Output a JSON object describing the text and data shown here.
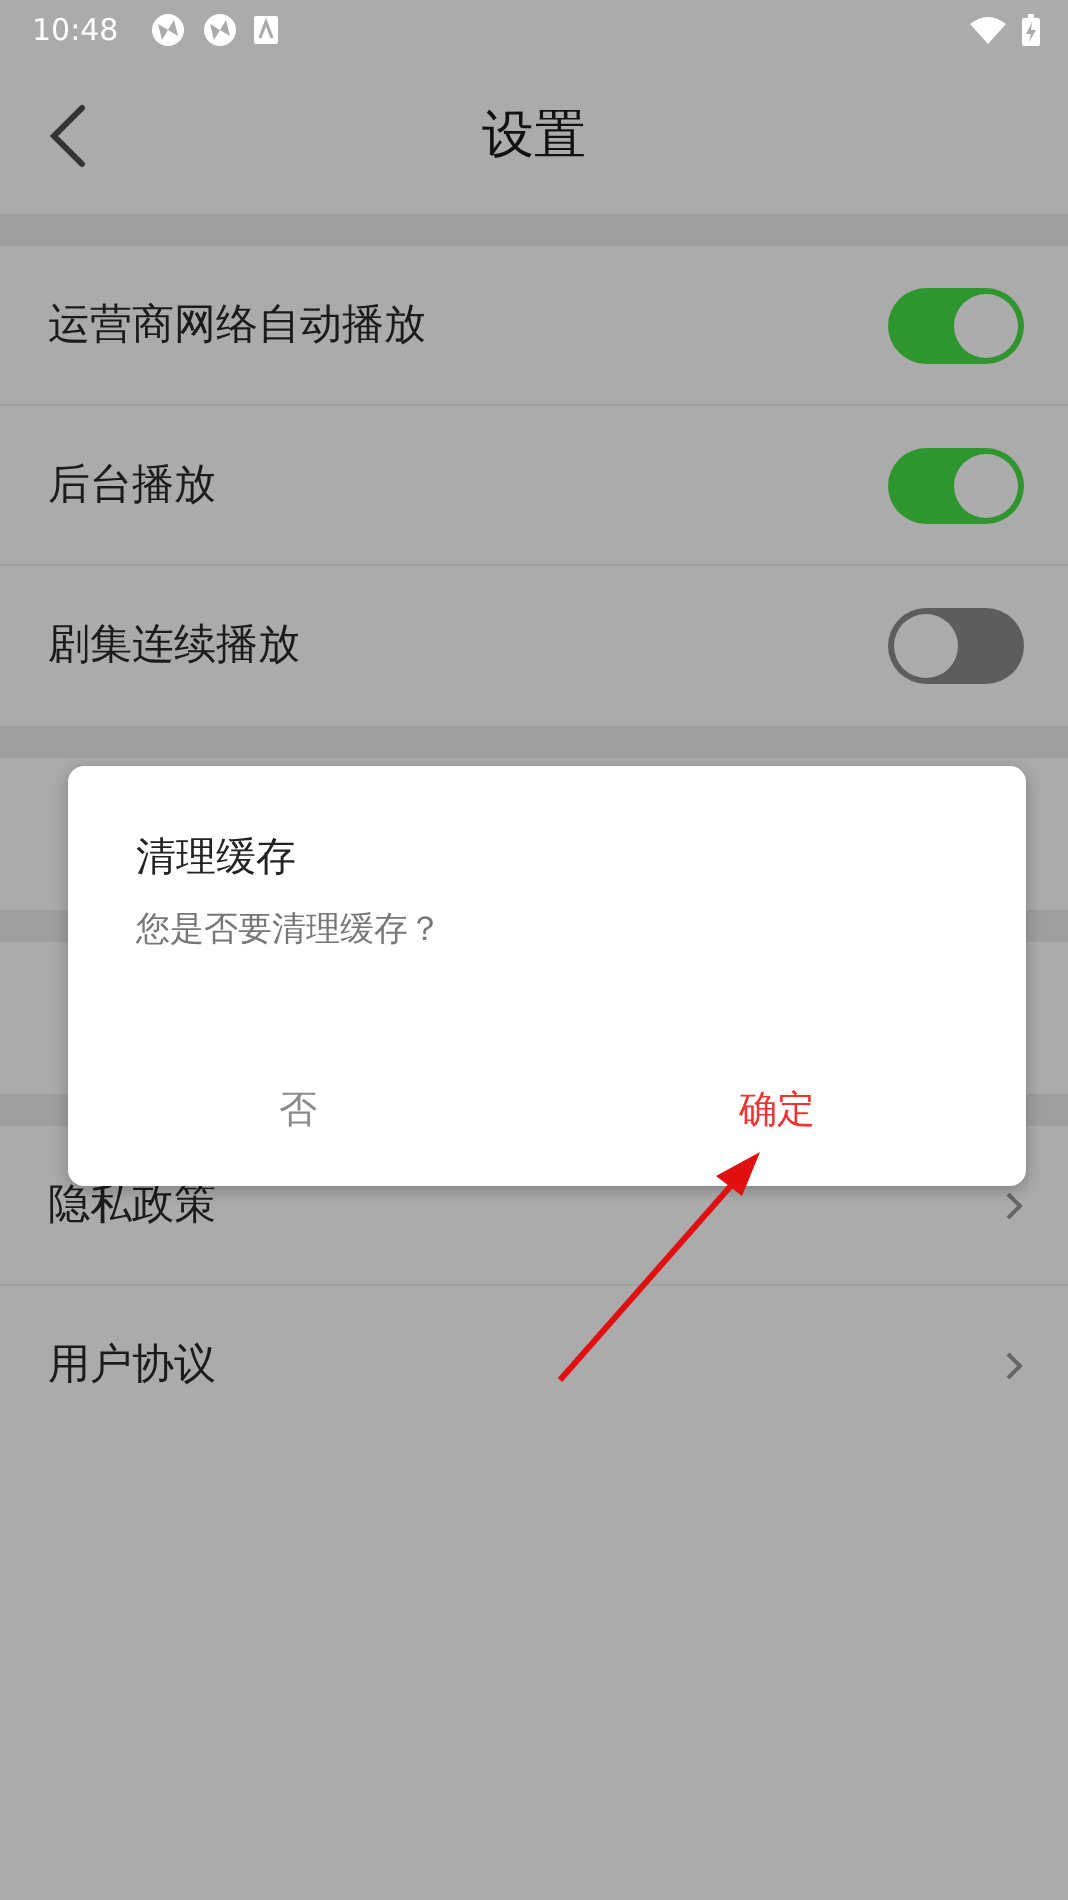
{
  "status_bar": {
    "time": "10:48"
  },
  "header": {
    "title": "设置"
  },
  "groups": [
    {
      "items": [
        {
          "kind": "toggle",
          "label": "运营商网络自动播放",
          "on": true
        },
        {
          "kind": "toggle",
          "label": "后台播放",
          "on": true
        },
        {
          "kind": "toggle",
          "label": "剧集连续播放",
          "on": false
        }
      ]
    },
    {
      "items": [
        {
          "kind": "covered"
        }
      ]
    },
    {
      "items": [
        {
          "kind": "covered"
        }
      ]
    },
    {
      "items": [
        {
          "kind": "link",
          "label": "隐私政策"
        },
        {
          "kind": "link",
          "label": "用户协议"
        }
      ]
    }
  ],
  "dialog": {
    "title": "清理缓存",
    "message": "您是否要清理缓存？",
    "buttons": [
      {
        "kind": "cancel",
        "label": "否"
      },
      {
        "kind": "confirm",
        "label": "确定"
      }
    ]
  }
}
